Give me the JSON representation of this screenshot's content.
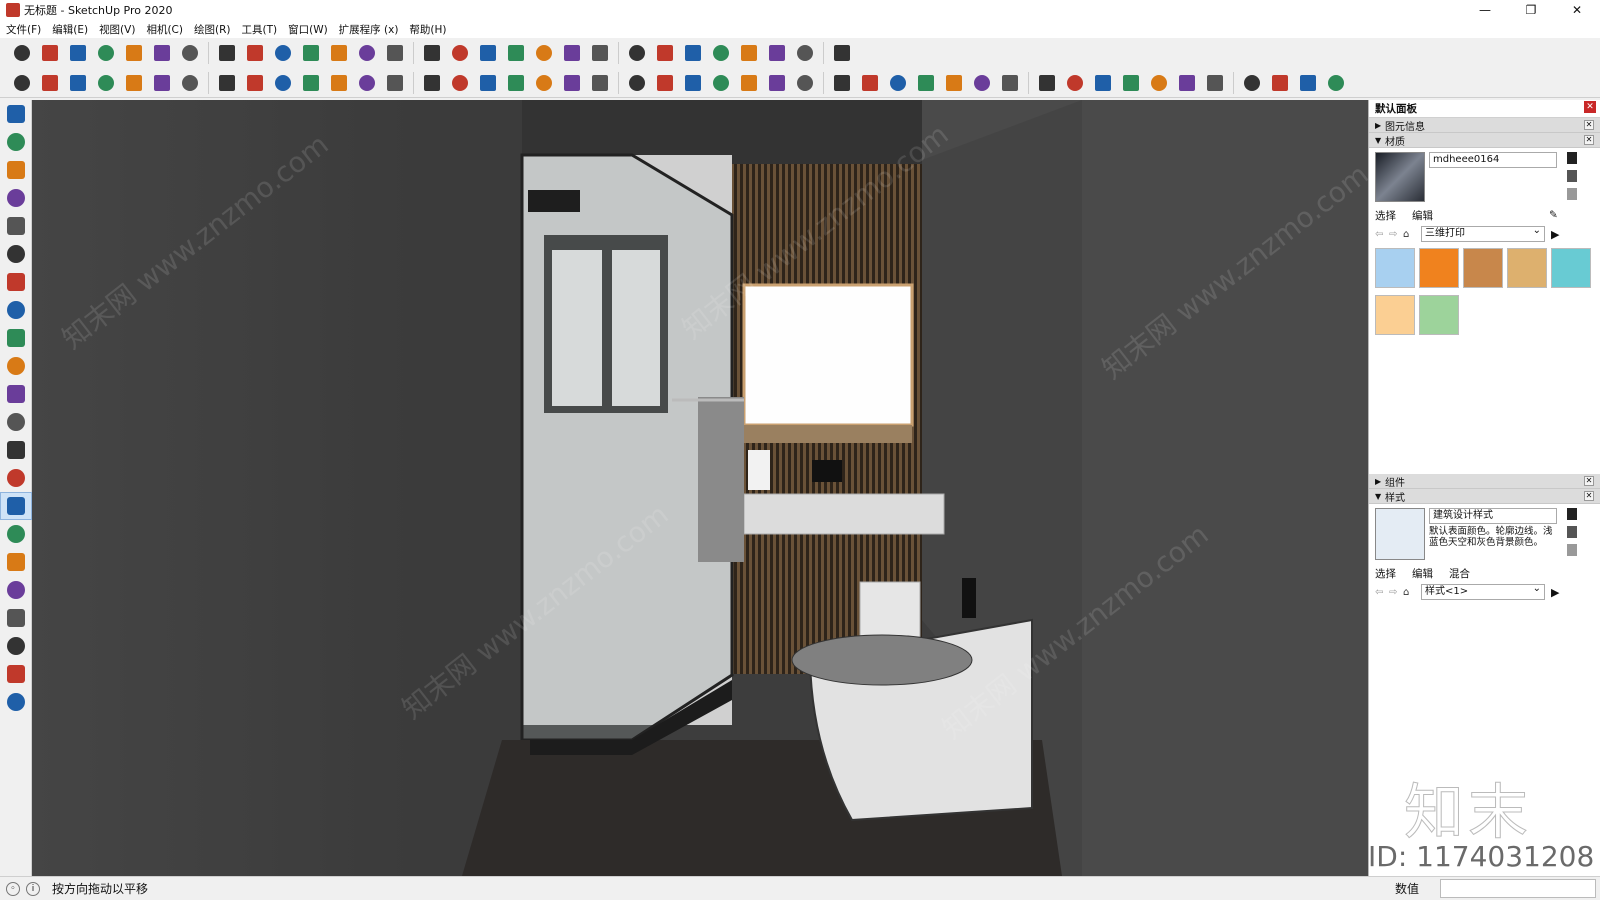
{
  "window": {
    "title": "无标题 - SketchUp Pro 2020",
    "minimize": "—",
    "maximize": "❐",
    "close": "✕"
  },
  "menu": [
    "文件(F)",
    "编辑(E)",
    "视图(V)",
    "相机(C)",
    "绘图(R)",
    "工具(T)",
    "窗口(W)",
    "扩展程序 (x)",
    "帮助(H)"
  ],
  "toolbar_icons": {
    "row1": [
      "curve-icon",
      "grid-icon",
      "line-icon",
      "bar-icon",
      "stairs-icon",
      "rail-icon",
      "mesh-icon",
      "bridge-icon",
      "arc-icon",
      "spiral-icon",
      "wand-icon",
      "extrude-icon",
      "pipe-icon",
      "layers-icon",
      "lattice-icon",
      "column-icon",
      "flip-icon",
      "box-icon",
      "dots-icon",
      "pen-icon",
      "brush-icon",
      "camera-icon",
      "screen-icon",
      "roof-icon",
      "door-icon",
      "house-icon",
      "shelf-icon",
      "home-icon",
      "cabinet-icon"
    ],
    "row2": [
      "orange-shape-icon",
      "refresh-icon",
      "stack-icon",
      "add-icon",
      "tree-icon",
      "flag-icon",
      "checker-icon",
      "cloud-icon",
      "gears-icon",
      "mail-icon",
      "info-icon",
      "user-icon",
      "move-icon",
      "pushpull-icon",
      "rotate-icon",
      "follow-icon",
      "scale-icon",
      "offset-icon",
      "orbit-icon",
      "iso-icon",
      "top-icon",
      "front-icon",
      "xray-icon",
      "wireframe-icon",
      "hidden-icon",
      "shaded-icon",
      "texture-icon",
      "mono-icon",
      "section-icon",
      "section-fill-icon",
      "section-cut-icon",
      "view-iso-icon",
      "view-top-icon",
      "view-front-icon",
      "view-right-icon",
      "view-back-icon",
      "sync-icon",
      "share-icon",
      "cloud-up-icon",
      "cloud-down-icon",
      "frame-icon",
      "atom-icon",
      "check-icon",
      "download-icon",
      "settings-icon",
      "chrome-icon"
    ]
  },
  "left_tools": [
    "select-icon",
    "eraser-icon",
    "pencil-icon",
    "arc-tool-icon",
    "shape-icon",
    "pushpull-tool-icon",
    "followme-icon",
    "move-tool-icon",
    "rotate-tool-icon",
    "scale-tool-icon",
    "tape-icon",
    "text-icon",
    "paint-icon",
    "orbit-tool-icon",
    "pan-icon",
    "zoom-icon",
    "zoom-extents-icon",
    "dynamic-icon",
    "components-icon",
    "ruby-icon",
    "gem-icon",
    "user-tool-icon"
  ],
  "panel": {
    "title": "默认面板",
    "entity_info": "图元信息",
    "materials": {
      "label": "材质",
      "name_value": "mdheee0164",
      "tabs": [
        "选择",
        "编辑"
      ],
      "library": "三维打印",
      "swatch_colors": [
        "#a8d0f0",
        "#f0821e",
        "#c8874b",
        "#ddb06e",
        "#68cbd3",
        "#fbcf93",
        "#9dd39b"
      ]
    },
    "components": "组件",
    "styles": {
      "label": "样式",
      "name_value": "建筑设计样式",
      "description": "默认表面颜色。轮廓边线。浅蓝色天空和灰色背景颜色。",
      "tabs": [
        "选择",
        "编辑",
        "混合"
      ],
      "library": "样式<1>"
    }
  },
  "viewport": {
    "watermarks": [
      "知末网 www.znzmo.com"
    ],
    "id_text": "ID: 1174031208",
    "logo_text": "知末"
  },
  "status": {
    "message": "按方向拖动以平移",
    "value_label": "数值",
    "value": ""
  }
}
